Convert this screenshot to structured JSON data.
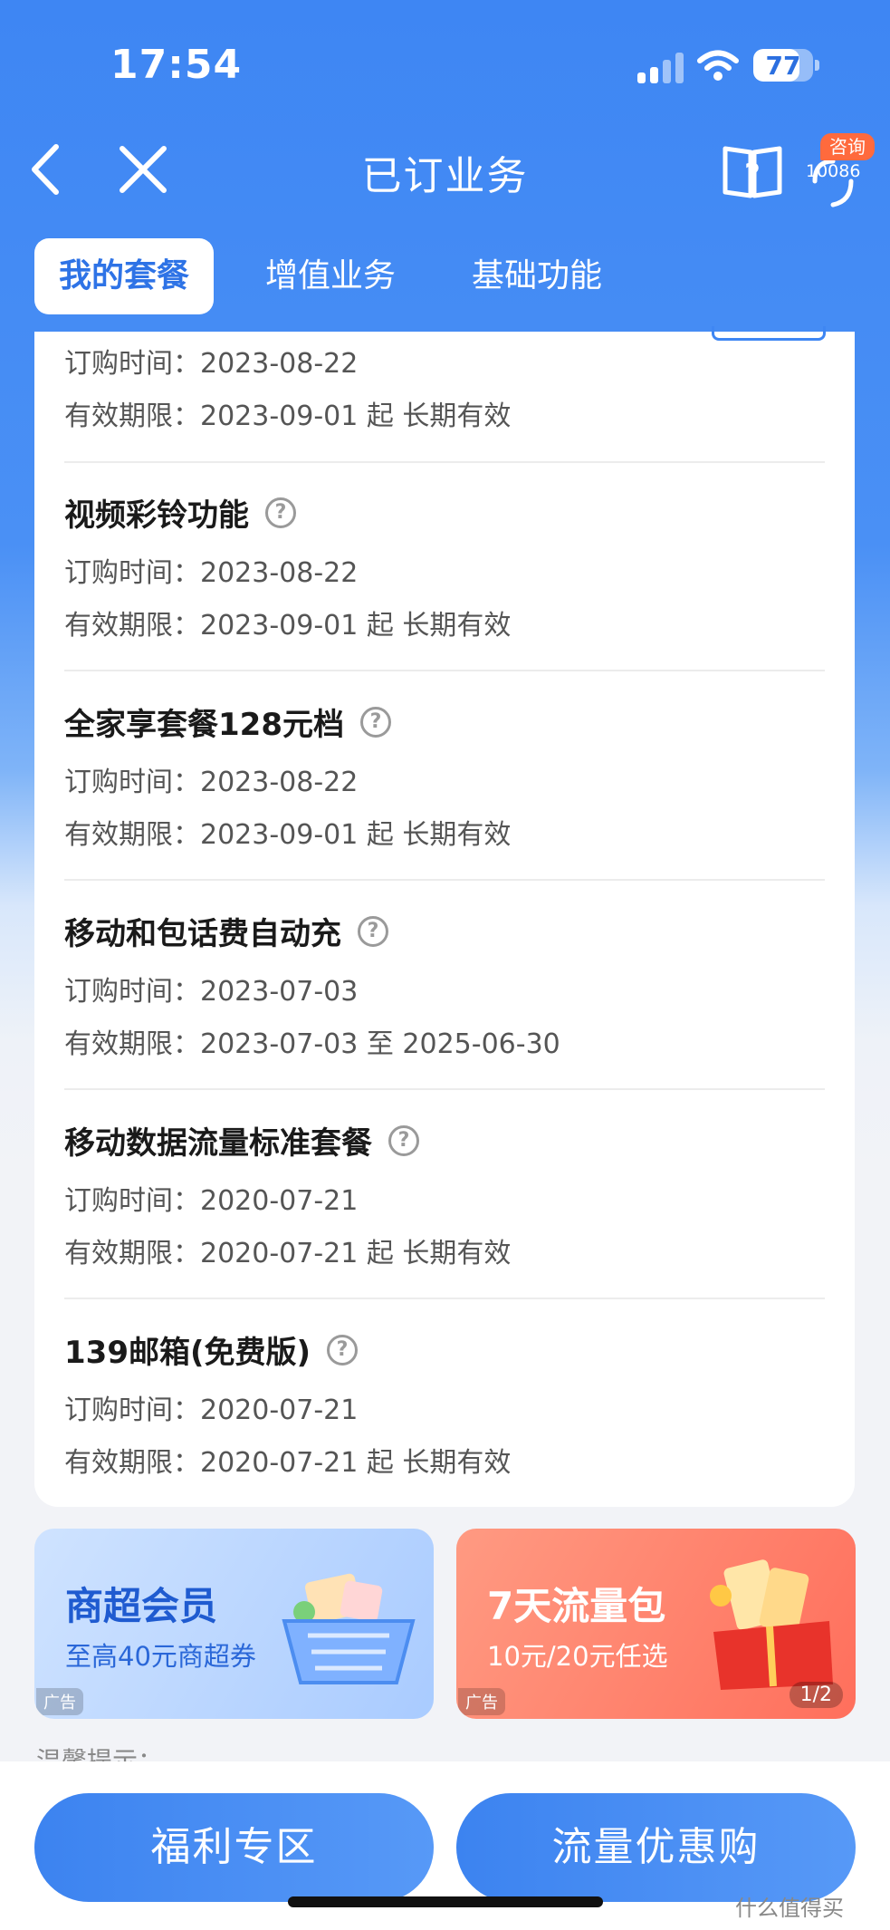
{
  "status_bar": {
    "time": "17:54",
    "battery": "77",
    "battery_level": 0.77
  },
  "nav": {
    "title": "已订业务",
    "consult_badge": "咨询",
    "consult_number": "10086"
  },
  "tabs": [
    {
      "label": "我的套餐",
      "active": true
    },
    {
      "label": "增值业务",
      "active": false
    },
    {
      "label": "基础功能",
      "active": false
    }
  ],
  "partial_item": {
    "order_time": "订购时间：2023-08-22",
    "validity": "有效期限：2023-09-01 起 长期有效"
  },
  "items": [
    {
      "name": "视频彩铃功能",
      "order_time": "订购时间：2023-08-22",
      "validity": "有效期限：2023-09-01 起 长期有效"
    },
    {
      "name": "全家享套餐128元档",
      "order_time": "订购时间：2023-08-22",
      "validity": "有效期限：2023-09-01 起 长期有效"
    },
    {
      "name": "移动和包话费自动充",
      "order_time": "订购时间：2023-07-03",
      "validity": "有效期限：2023-07-03 至 2025-06-30"
    },
    {
      "name": "移动数据流量标准套餐",
      "order_time": "订购时间：2020-07-21",
      "validity": "有效期限：2020-07-21 起 长期有效"
    },
    {
      "name": "139邮箱(免费版)",
      "order_time": "订购时间：2020-07-21",
      "validity": "有效期限：2020-07-21 起 长期有效"
    }
  ],
  "help_glyph": "?",
  "ads": [
    {
      "title": "商超会员",
      "subtitle": "至高40元商超券",
      "tag": "广告",
      "title_color": "#1f5bd0",
      "subtitle_color": "#2a67d8"
    },
    {
      "title": "7天流量包",
      "subtitle": "10元/20元任选",
      "tag": "广告",
      "pager": "1/2",
      "title_color": "#ffffff",
      "subtitle_color": "#ffffff"
    }
  ],
  "tip_text": "温馨提示：",
  "bottom_buttons": {
    "left": "福利专区",
    "right": "流量优惠购"
  },
  "watermark": "什么值得买",
  "colors": {
    "accent": "#3e86f3",
    "badge": "#ff6a3d"
  }
}
